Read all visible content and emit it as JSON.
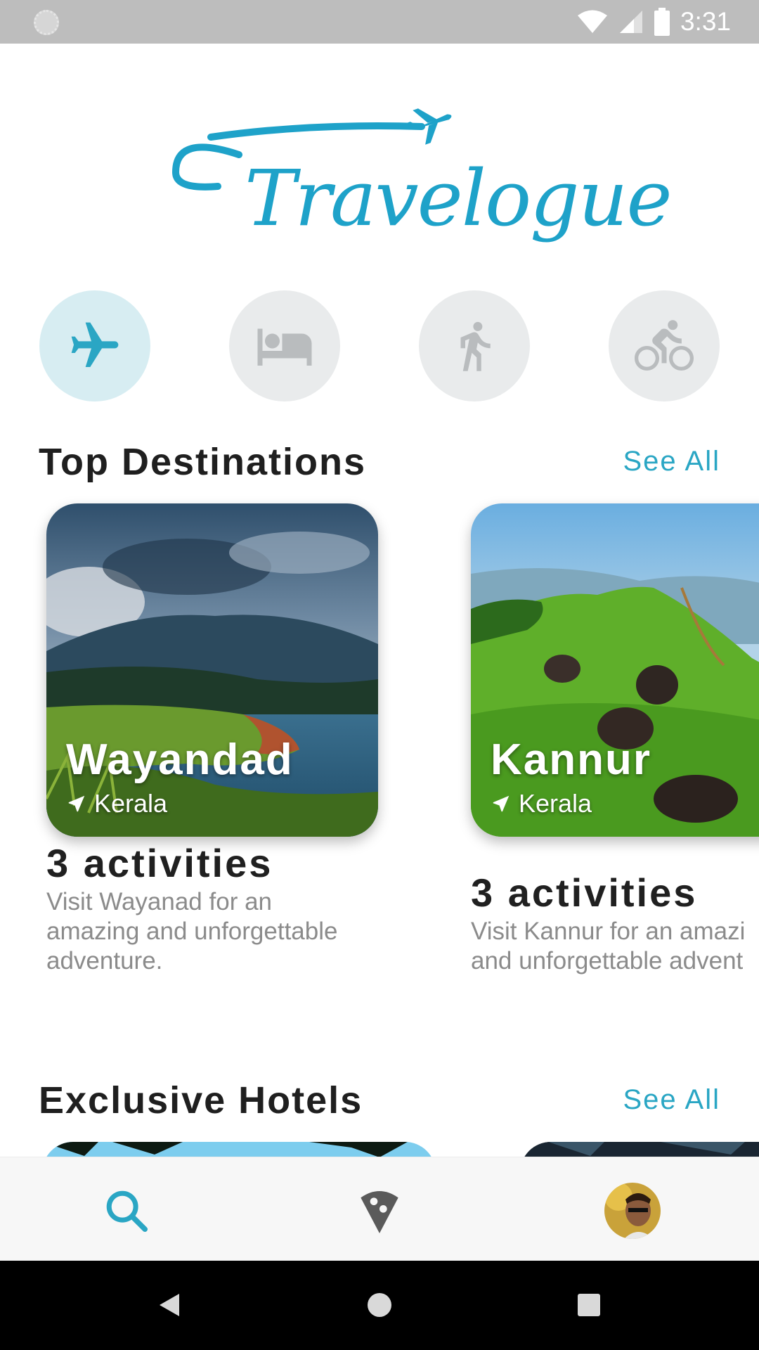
{
  "status_bar": {
    "time": "3:31"
  },
  "app": {
    "logo_text": "Travelogue"
  },
  "categories": [
    {
      "icon": "airplane-icon",
      "active": true
    },
    {
      "icon": "bed-icon",
      "active": false
    },
    {
      "icon": "walking-person-icon",
      "active": false
    },
    {
      "icon": "bicycle-icon",
      "active": false
    }
  ],
  "top_destinations": {
    "title": "Top Destinations",
    "see_all": "See All",
    "cards": [
      {
        "name": "Wayandad",
        "location": "Kerala",
        "activities": "3 activities",
        "description_lines": [
          "Visit Wayanad for an",
          "amazing and unforgettable",
          "adventure."
        ]
      },
      {
        "name": "Kannur",
        "location": "Kerala",
        "activities": "3 activities",
        "description_lines": [
          "Visit Kannur for an amazi",
          "and unforgettable advent"
        ]
      }
    ]
  },
  "exclusive_hotels": {
    "title": "Exclusive Hotels",
    "see_all": "See All"
  },
  "bottom_nav": [
    {
      "icon": "search-icon",
      "active": true
    },
    {
      "icon": "map-pin-icon",
      "active": false
    },
    {
      "icon": "profile-avatar",
      "active": false
    }
  ],
  "colors": {
    "accent": "#2aa6c4",
    "logo": "#1ea2c9",
    "category_bg": "#e9ebec",
    "category_active_bg": "#d7edf2",
    "status_bar": "#bdbdbd"
  }
}
